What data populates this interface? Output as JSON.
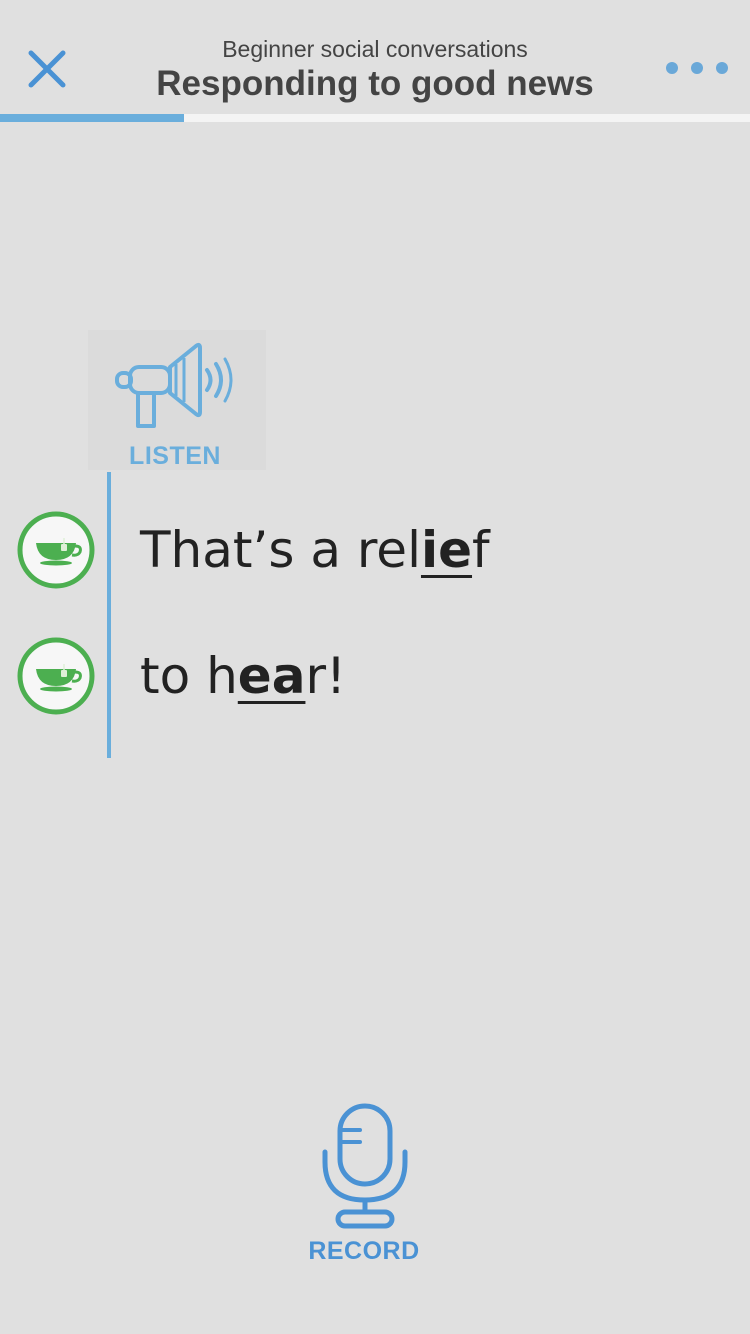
{
  "header": {
    "subtitle": "Beginner social conversations",
    "title": "Responding to good news",
    "close_icon": "close-icon",
    "more_icon": "more-dots-icon"
  },
  "progress": {
    "fraction": 0.245
  },
  "listen": {
    "label": "LISTEN",
    "icon": "megaphone-icon"
  },
  "phrases": [
    {
      "icon": "teacup-icon",
      "pre": "That’s a rel",
      "highlight": "ie",
      "post": "f"
    },
    {
      "icon": "teacup-icon",
      "pre": "to h",
      "highlight": "ea",
      "post": "r!"
    }
  ],
  "record": {
    "label": "RECORD",
    "icon": "microphone-icon"
  },
  "colors": {
    "background": "#e0e0e0",
    "accent_blue": "#6aaedc",
    "record_blue": "#4a92d4",
    "icon_green": "#4caf50",
    "text_dark": "#222222",
    "title_gray": "#444444"
  }
}
